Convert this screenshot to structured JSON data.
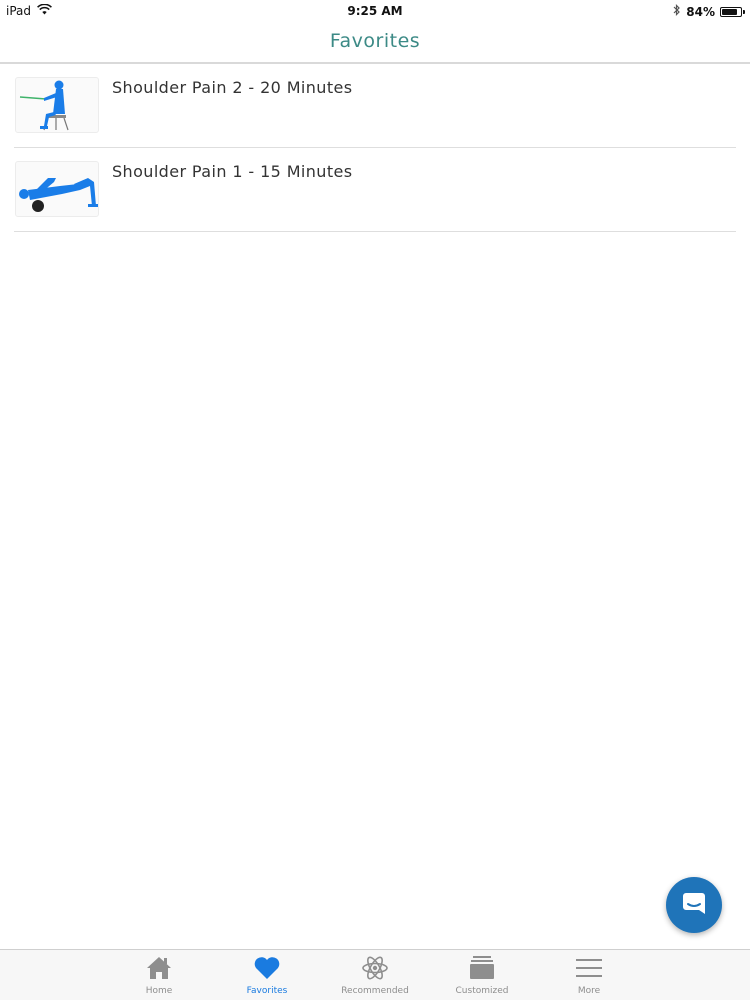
{
  "status_bar": {
    "device": "iPad",
    "time": "9:25 AM",
    "battery_percent": "84%",
    "battery_level": 0.84
  },
  "nav": {
    "title": "Favorites"
  },
  "favorites": [
    {
      "title": "Shoulder Pain 2 - 20 Minutes",
      "thumbnail_icon": "seated-row-exercise-figure"
    },
    {
      "title": "Shoulder Pain 1 - 15 Minutes",
      "thumbnail_icon": "foam-roller-exercise-figure"
    }
  ],
  "chat_button": {
    "icon": "chat-bubble-icon"
  },
  "tabs": [
    {
      "label": "Home",
      "icon": "home-icon",
      "active": false
    },
    {
      "label": "Favorites",
      "icon": "heart-icon",
      "active": true
    },
    {
      "label": "Recommended",
      "icon": "atom-icon",
      "active": false
    },
    {
      "label": "Customized",
      "icon": "stack-icon",
      "active": false
    },
    {
      "label": "More",
      "icon": "menu-icon",
      "active": false
    }
  ],
  "colors": {
    "title_teal": "#3c8a86",
    "accent_blue": "#1a7be0",
    "fab_blue": "#1f74b9",
    "figure_blue": "#1a7de8"
  }
}
